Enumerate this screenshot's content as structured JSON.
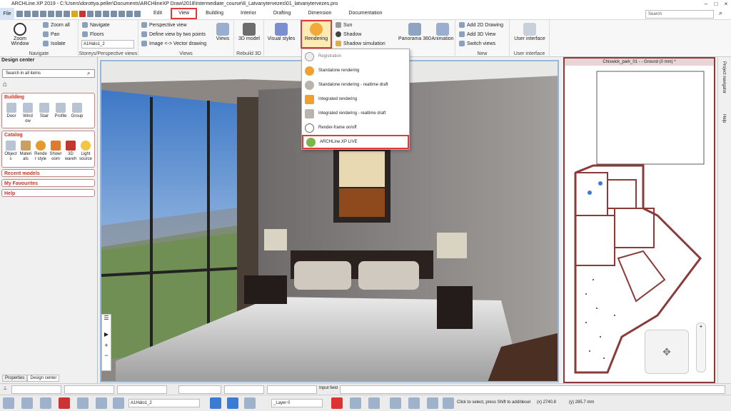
{
  "title": "ARCHLine.XP 2019 - C:\\Users\\dorottya.peller\\Documents\\ARCHlineXP Draw\\2018\\Intermediate_course\\8_Latvanytervezes\\01_latvanytervezes.pro",
  "menu": {
    "file": "File",
    "tabs": [
      "Edit",
      "View",
      "Building",
      "Interior",
      "Drafting",
      "Dimension",
      "Documentation"
    ],
    "active_tab": "View"
  },
  "search": {
    "placeholder": "Search"
  },
  "ribbon": {
    "navigate": {
      "zoom_window": "Zoom Window",
      "zoom_all": "Zoom all",
      "pan": "Pan",
      "isolate": "Isolate",
      "label": "Navigate"
    },
    "storeys": {
      "navigate": "Navigate",
      "floors": "Floors",
      "storey": "A1Hálo1_2",
      "label": "Storeys/Perspective views"
    },
    "views": {
      "perspective": "Perspective view",
      "define": "Define view by two points",
      "image": "Image <-> Vector drawing",
      "views_btn": "Views",
      "label": "Views"
    },
    "rebuild": {
      "model": "3D model",
      "label": "Rebuild 3D"
    },
    "visual": {
      "visual_styles": "Visual styles",
      "rendering": "Rendering",
      "sun": "Sun",
      "shadow": "Shadow",
      "shadow_sim": "Shadow simulation",
      "panorama": "Panorama 360",
      "animation": "Animation"
    },
    "new": {
      "add2d": "Add 2D Drawing",
      "add3d": "Add 3D View",
      "switch": "Switch views",
      "label": "New"
    },
    "ui": {
      "label_btn": "User interface",
      "label": "User interface"
    }
  },
  "rendering_menu": [
    "Registration",
    "Standalone rendering",
    "Standalone rendering - realtime draft",
    "Integrated rendering",
    "Integrated rendering - realtime draft",
    "Render-frame on/off",
    "ARCHLine.XP LIVE"
  ],
  "design_center": {
    "title": "Design center",
    "search_placeholder": "Search in all items",
    "building": {
      "title": "Building",
      "items": [
        "Door",
        "Wind ow",
        "Stair",
        "Profile",
        "Group"
      ]
    },
    "catalog": {
      "title": "Catalog",
      "items": [
        "Object s",
        "Materi als",
        "Rende r style",
        "Showr oom",
        "3D wareh",
        "Light source"
      ]
    },
    "recent": "Recent models",
    "favourites": "My Favourites",
    "help": "Help",
    "tabs": [
      "Properties",
      "Design center"
    ]
  },
  "plan": {
    "title": "Chiswick_park_01 - - Ground (0 mm) *"
  },
  "side_panel": {
    "project_navigator": "Project navigator",
    "help": "Help"
  },
  "status": {
    "input_field": "Input field",
    "layer": "A1Hálo1_2",
    "layer0": "_Layer 0",
    "hint": "Click to select, press Shift to add/desel",
    "x": "(x) 2740.8",
    "y": "(y) 285.7 mm"
  }
}
